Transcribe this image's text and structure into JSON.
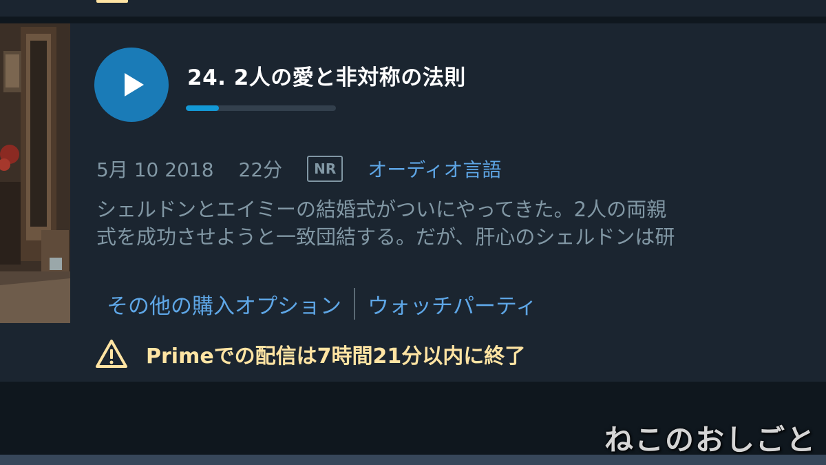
{
  "colors": {
    "page_background": "#0f171e",
    "card_background": "#1b2530",
    "play_button": "#1a7bb7",
    "progress_accent": "#1399d6",
    "link": "#5ea6e6",
    "muted_text": "#8197a4",
    "warning": "#ffe4a3"
  },
  "episode": {
    "title": "24. 2人の愛と非対称の法則",
    "progress_fraction": 0.22,
    "play_icon": "play-icon",
    "thumbnail_icon": "episode-thumbnail-image"
  },
  "meta": {
    "date": "5月 10 2018",
    "duration": "22分",
    "rating": "NR",
    "audio_languages_link": "オーディオ言語"
  },
  "synopsis": {
    "line1": "シェルドンとエイミーの結婚式がついにやってきた。2人の両親",
    "line2": "式を成功させようと一致団結する。だが、肝心のシェルドンは研"
  },
  "links": {
    "more_purchase_options": "その他の購入オプション",
    "watch_party": "ウォッチパーティ"
  },
  "notice": {
    "icon": "warning-triangle-icon",
    "text": "Primeでの配信は7時間21分以内に終了"
  },
  "watermark": {
    "text": "ねこのおしごと"
  }
}
